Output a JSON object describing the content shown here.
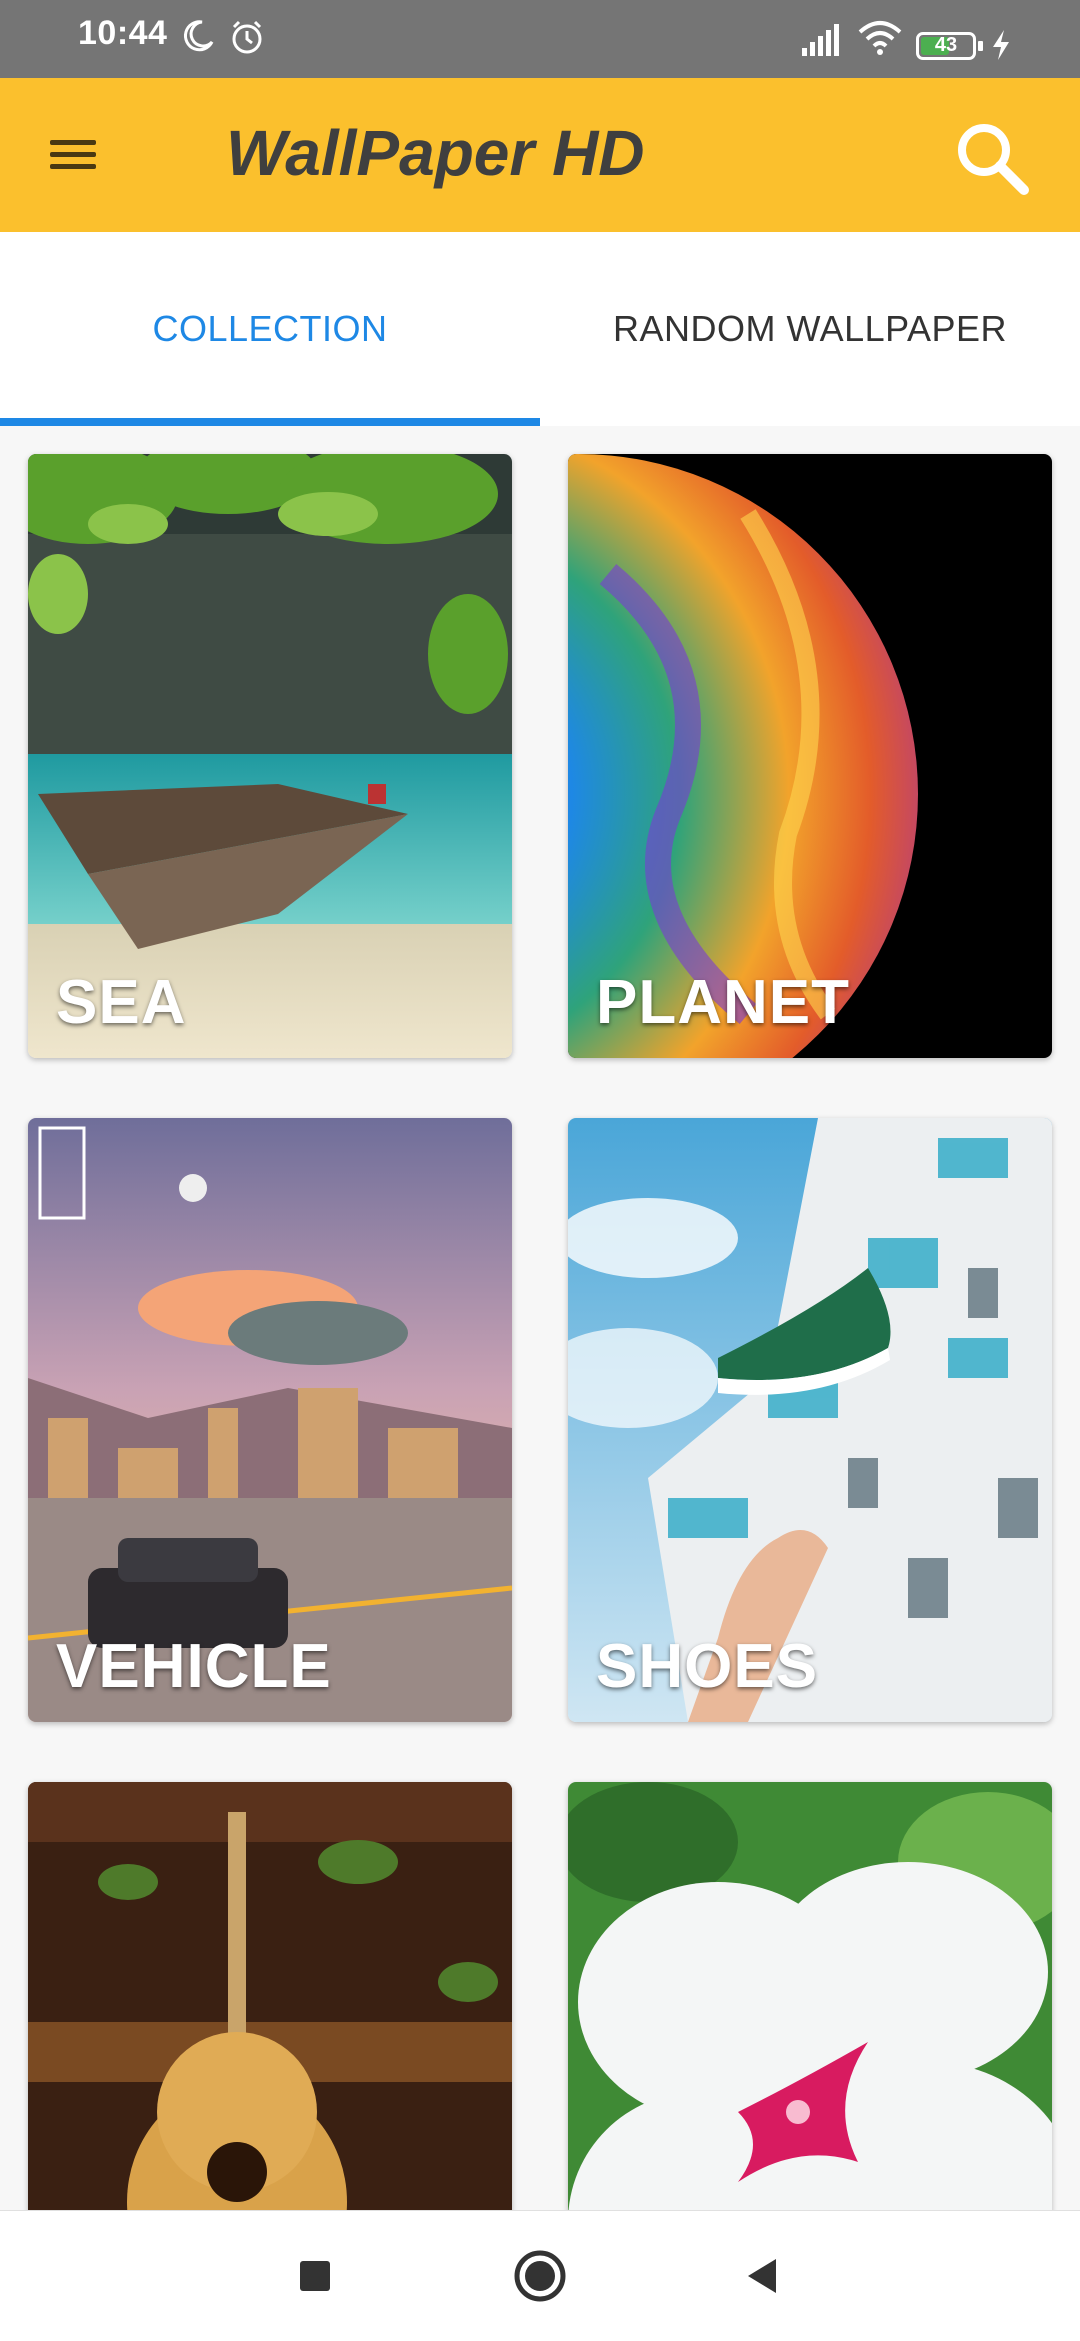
{
  "status_bar": {
    "time": "10:44",
    "battery": "43",
    "icons": [
      "moon-icon",
      "alarm-icon",
      "signal-icon",
      "wifi-icon",
      "battery-icon",
      "charging-icon"
    ]
  },
  "app_bar": {
    "title": "WallPaper HD",
    "menu_icon": "hamburger-menu-icon",
    "search_icon": "search-icon",
    "color": "#fbc02d"
  },
  "tabs": [
    {
      "label": "COLLECTION",
      "active": true
    },
    {
      "label": "RANDOM WALLPAPER",
      "active": false
    }
  ],
  "accent_color": "#1e88e5",
  "collections": [
    {
      "label": "SEA"
    },
    {
      "label": "PLANET"
    },
    {
      "label": "VEHICLE"
    },
    {
      "label": "SHOES"
    },
    {
      "label": ""
    },
    {
      "label": ""
    }
  ],
  "nav_bar": {
    "icons": [
      "recents-square-icon",
      "home-circle-icon",
      "back-triangle-icon"
    ]
  }
}
